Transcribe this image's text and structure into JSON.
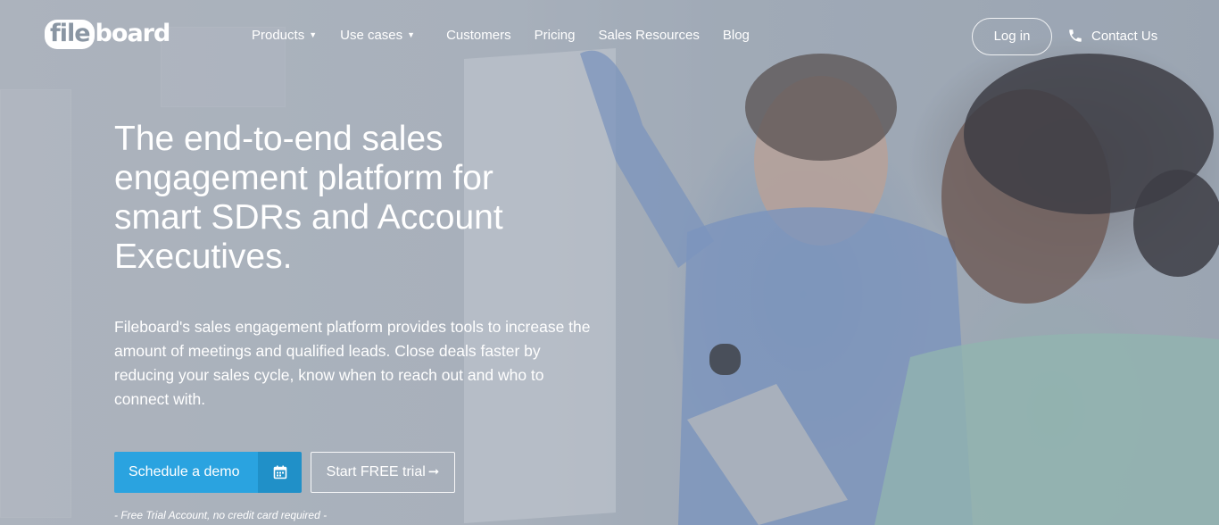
{
  "brand": {
    "logo_prefix": "file",
    "logo_suffix": "board"
  },
  "nav": {
    "items": [
      {
        "label": "Products",
        "has_dropdown": true
      },
      {
        "label": "Use cases",
        "has_dropdown": true
      },
      {
        "label": "Customers",
        "has_dropdown": false
      },
      {
        "label": "Pricing",
        "has_dropdown": false
      },
      {
        "label": "Sales Resources",
        "has_dropdown": false
      },
      {
        "label": "Blog",
        "has_dropdown": false
      }
    ],
    "login_label": "Log in",
    "contact_label": "Contact Us",
    "contact_icon": "phone-icon"
  },
  "hero": {
    "headline": "The end-to-end sales engagement platform for smart SDRs and Account Executives.",
    "subcopy": "Fileboard's sales engagement platform provides tools to increase the amount of meetings and qualified leads. Close deals faster by reducing your sales cycle, know when to reach out and who to connect with.",
    "demo_label": "Schedule a demo",
    "demo_icon": "calendar-icon",
    "trial_label": "Start FREE trial",
    "trial_icon": "arrow-right-icon",
    "note": "- Free Trial Account, no credit card required -"
  },
  "colors": {
    "primary_button": "#2aa3e0",
    "primary_button_icon_bg": "#2090c8"
  }
}
